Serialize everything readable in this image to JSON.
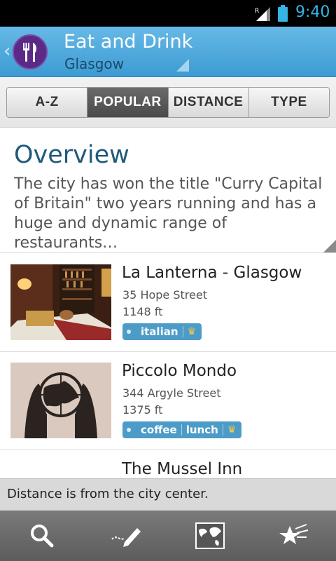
{
  "status": {
    "time": "9:40",
    "network_label": "R"
  },
  "header": {
    "title": "Eat and Drink",
    "subtitle": "Glasgow"
  },
  "tabs": [
    {
      "label": "A-Z",
      "active": false
    },
    {
      "label": "POPULAR",
      "active": true
    },
    {
      "label": "DISTANCE",
      "active": false
    },
    {
      "label": "TYPE",
      "active": false
    }
  ],
  "overview": {
    "heading": "Overview",
    "text": "The city has won the title \"Curry Capital of Britain\" two years running and has a huge and dynamic range of restaurants…"
  },
  "places": [
    {
      "name": "La Lanterna - Glasgow",
      "address": "35 Hope Street",
      "distance": "1148 ft",
      "tags": [
        "italian"
      ],
      "premium": true
    },
    {
      "name": "Piccolo Mondo",
      "address": "344 Argyle Street",
      "distance": "1375 ft",
      "tags": [
        "coffee",
        "lunch"
      ],
      "premium": true
    },
    {
      "name": "The Mussel Inn"
    }
  ],
  "notice": "Distance is from the city center.",
  "icons": {
    "back": "chevron-left-icon",
    "logo": "fork-knife-icon",
    "dropdown": "dropdown-triangle-icon",
    "bottom": [
      "search-icon",
      "edit-icon",
      "map-icon",
      "favorites-icon"
    ],
    "premium": "crown-icon"
  },
  "colors": {
    "accent": "#33b5e5",
    "header": "#4aa7dc",
    "tag": "#4d9cc8",
    "heading": "#1f5a7a"
  }
}
